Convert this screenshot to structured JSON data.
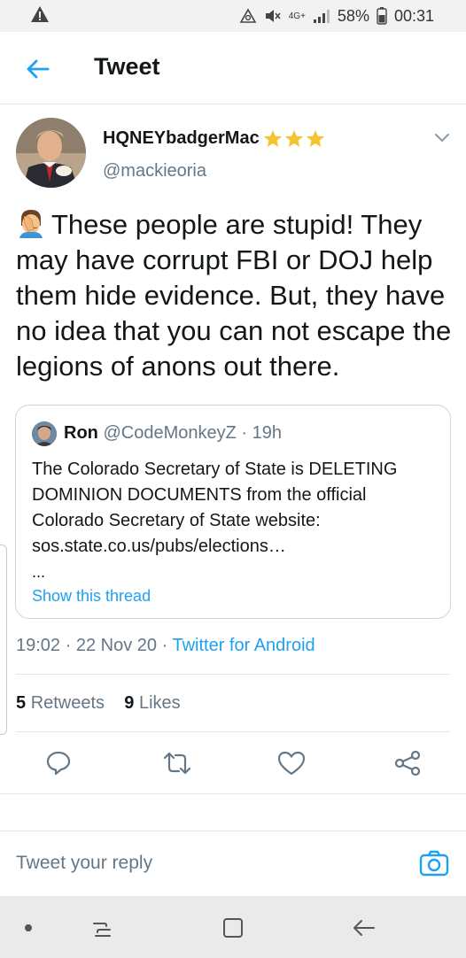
{
  "status_bar": {
    "network": "4G+",
    "battery": "58%",
    "time": "00:31"
  },
  "header": {
    "title": "Tweet",
    "back_icon": "arrow-left-icon"
  },
  "tweet": {
    "display_name": "HQNEYbadgerMac",
    "badges": [
      "star",
      "star",
      "star"
    ],
    "handle": "@mackieoria",
    "emoji": "facepalm-emoji",
    "text": "These people are stupid! They may have corrupt FBI or DOJ help them hide evidence. But, they have no idea that you can not escape the legions of anons out there.",
    "time": "19:02",
    "date": "22 Nov 20",
    "separator": "·",
    "source": "Twitter for Android",
    "retweets_count": "5",
    "retweets_label": "Retweets",
    "likes_count": "9",
    "likes_label": "Likes"
  },
  "quoted": {
    "name": "Ron",
    "handle": "@CodeMonkeyZ",
    "age": "· 19h",
    "text": "The Colorado Secretary of State is DELETING DOMINION DOCUMENTS from the official Colorado Secretary of State website: sos.state.co.us/pubs/elections…",
    "ellipsis": "...",
    "thread_link": "Show this thread"
  },
  "reply": {
    "placeholder": "Tweet your reply"
  },
  "colors": {
    "accent": "#1da1f2",
    "secondary_text": "#657786",
    "star": "#f4c430"
  }
}
